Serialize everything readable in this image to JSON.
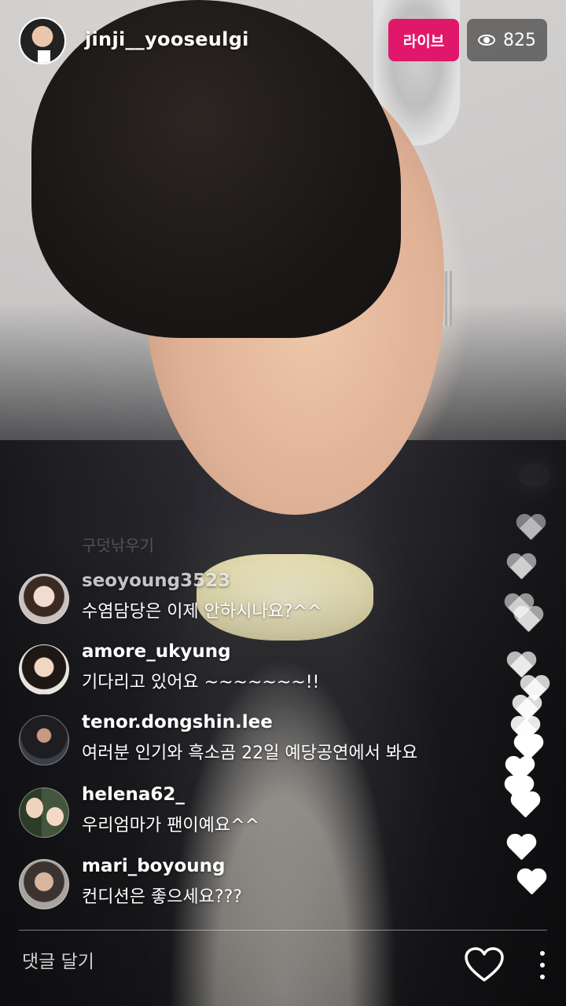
{
  "header": {
    "host_name": "jinji__yooseulgi",
    "live_label": "라이브",
    "viewer_count": "825"
  },
  "comments": [
    {
      "user": "seoyoung3523",
      "text": "수염담당은 이제 안하시나요?^^"
    },
    {
      "user": "amore_ukyung",
      "text": "기다리고 있어요 ~~~~~~~!!"
    },
    {
      "user": "tenor.dongshin.lee",
      "text": "여러분 인기와 흑소곰 22일 예당공연에서 봐요"
    },
    {
      "user": "helena62_",
      "text": "우리엄마가 팬이예요^^"
    },
    {
      "user": "mari_boyoung",
      "text": "컨디션은 좋으세요???"
    }
  ],
  "faded_comment": "구덧낚우기",
  "footer": {
    "comment_placeholder": "댓글 달기"
  },
  "icons": [
    "eye-icon",
    "heart-icon",
    "more-options-icon"
  ],
  "colors": {
    "live_badge": "#e0176b"
  }
}
